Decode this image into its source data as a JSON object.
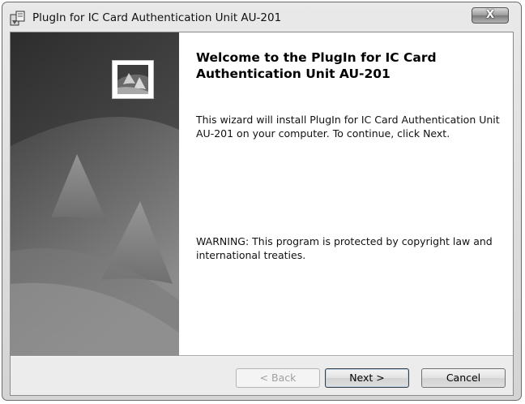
{
  "window": {
    "title": "PlugIn for IC Card Authentication Unit AU-201",
    "close_label": "X"
  },
  "main": {
    "heading": "Welcome to the PlugIn for IC Card Authentication Unit AU-201",
    "intro": "This wizard will install PlugIn for IC Card Authentication Unit AU-201 on your computer. To continue, click Next.",
    "warning": "WARNING: This program is protected by copyright law and international treaties."
  },
  "buttons": {
    "back": "< Back",
    "next": "Next >",
    "cancel": "Cancel"
  },
  "icons": {
    "app": "installer-icon",
    "logo": "installer-logo-icon",
    "close": "close-icon"
  }
}
